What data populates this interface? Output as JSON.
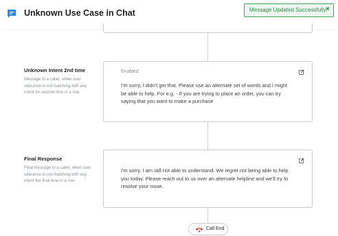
{
  "header": {
    "title": "Unknown Use Case in Chat",
    "app_icon": "chat-bubble-icon",
    "accent": "#2f86de"
  },
  "toast": {
    "message": "Message Updated Successfully!",
    "close_glyph": "×",
    "color": "#3ca55c"
  },
  "sections": [
    {
      "title": "Unknown Intent 2nd time",
      "description": "Message to a caller, when user utterance in not matching with any intent for second time in a row.",
      "badge": "Enabled",
      "message": "I'm sorry, I didn't get that. Please use an alternate set of words and I might be able to help. For e.g. - If you are trying to place an order, you can try saying that you want to make a purchase"
    },
    {
      "title": "Final Response",
      "description": "Final message to a caller, when user utterance in not matching with any intent the final time in a row.",
      "message": "I'm sorry. I am still not able to understand. We regret not being able to help you today. Please reach out to us over an alternate helpline and we'll try to resolve your issue."
    }
  ],
  "call_end": {
    "label": "Call End",
    "icon": "phone-hangup-icon",
    "color": "#d93a3a"
  }
}
